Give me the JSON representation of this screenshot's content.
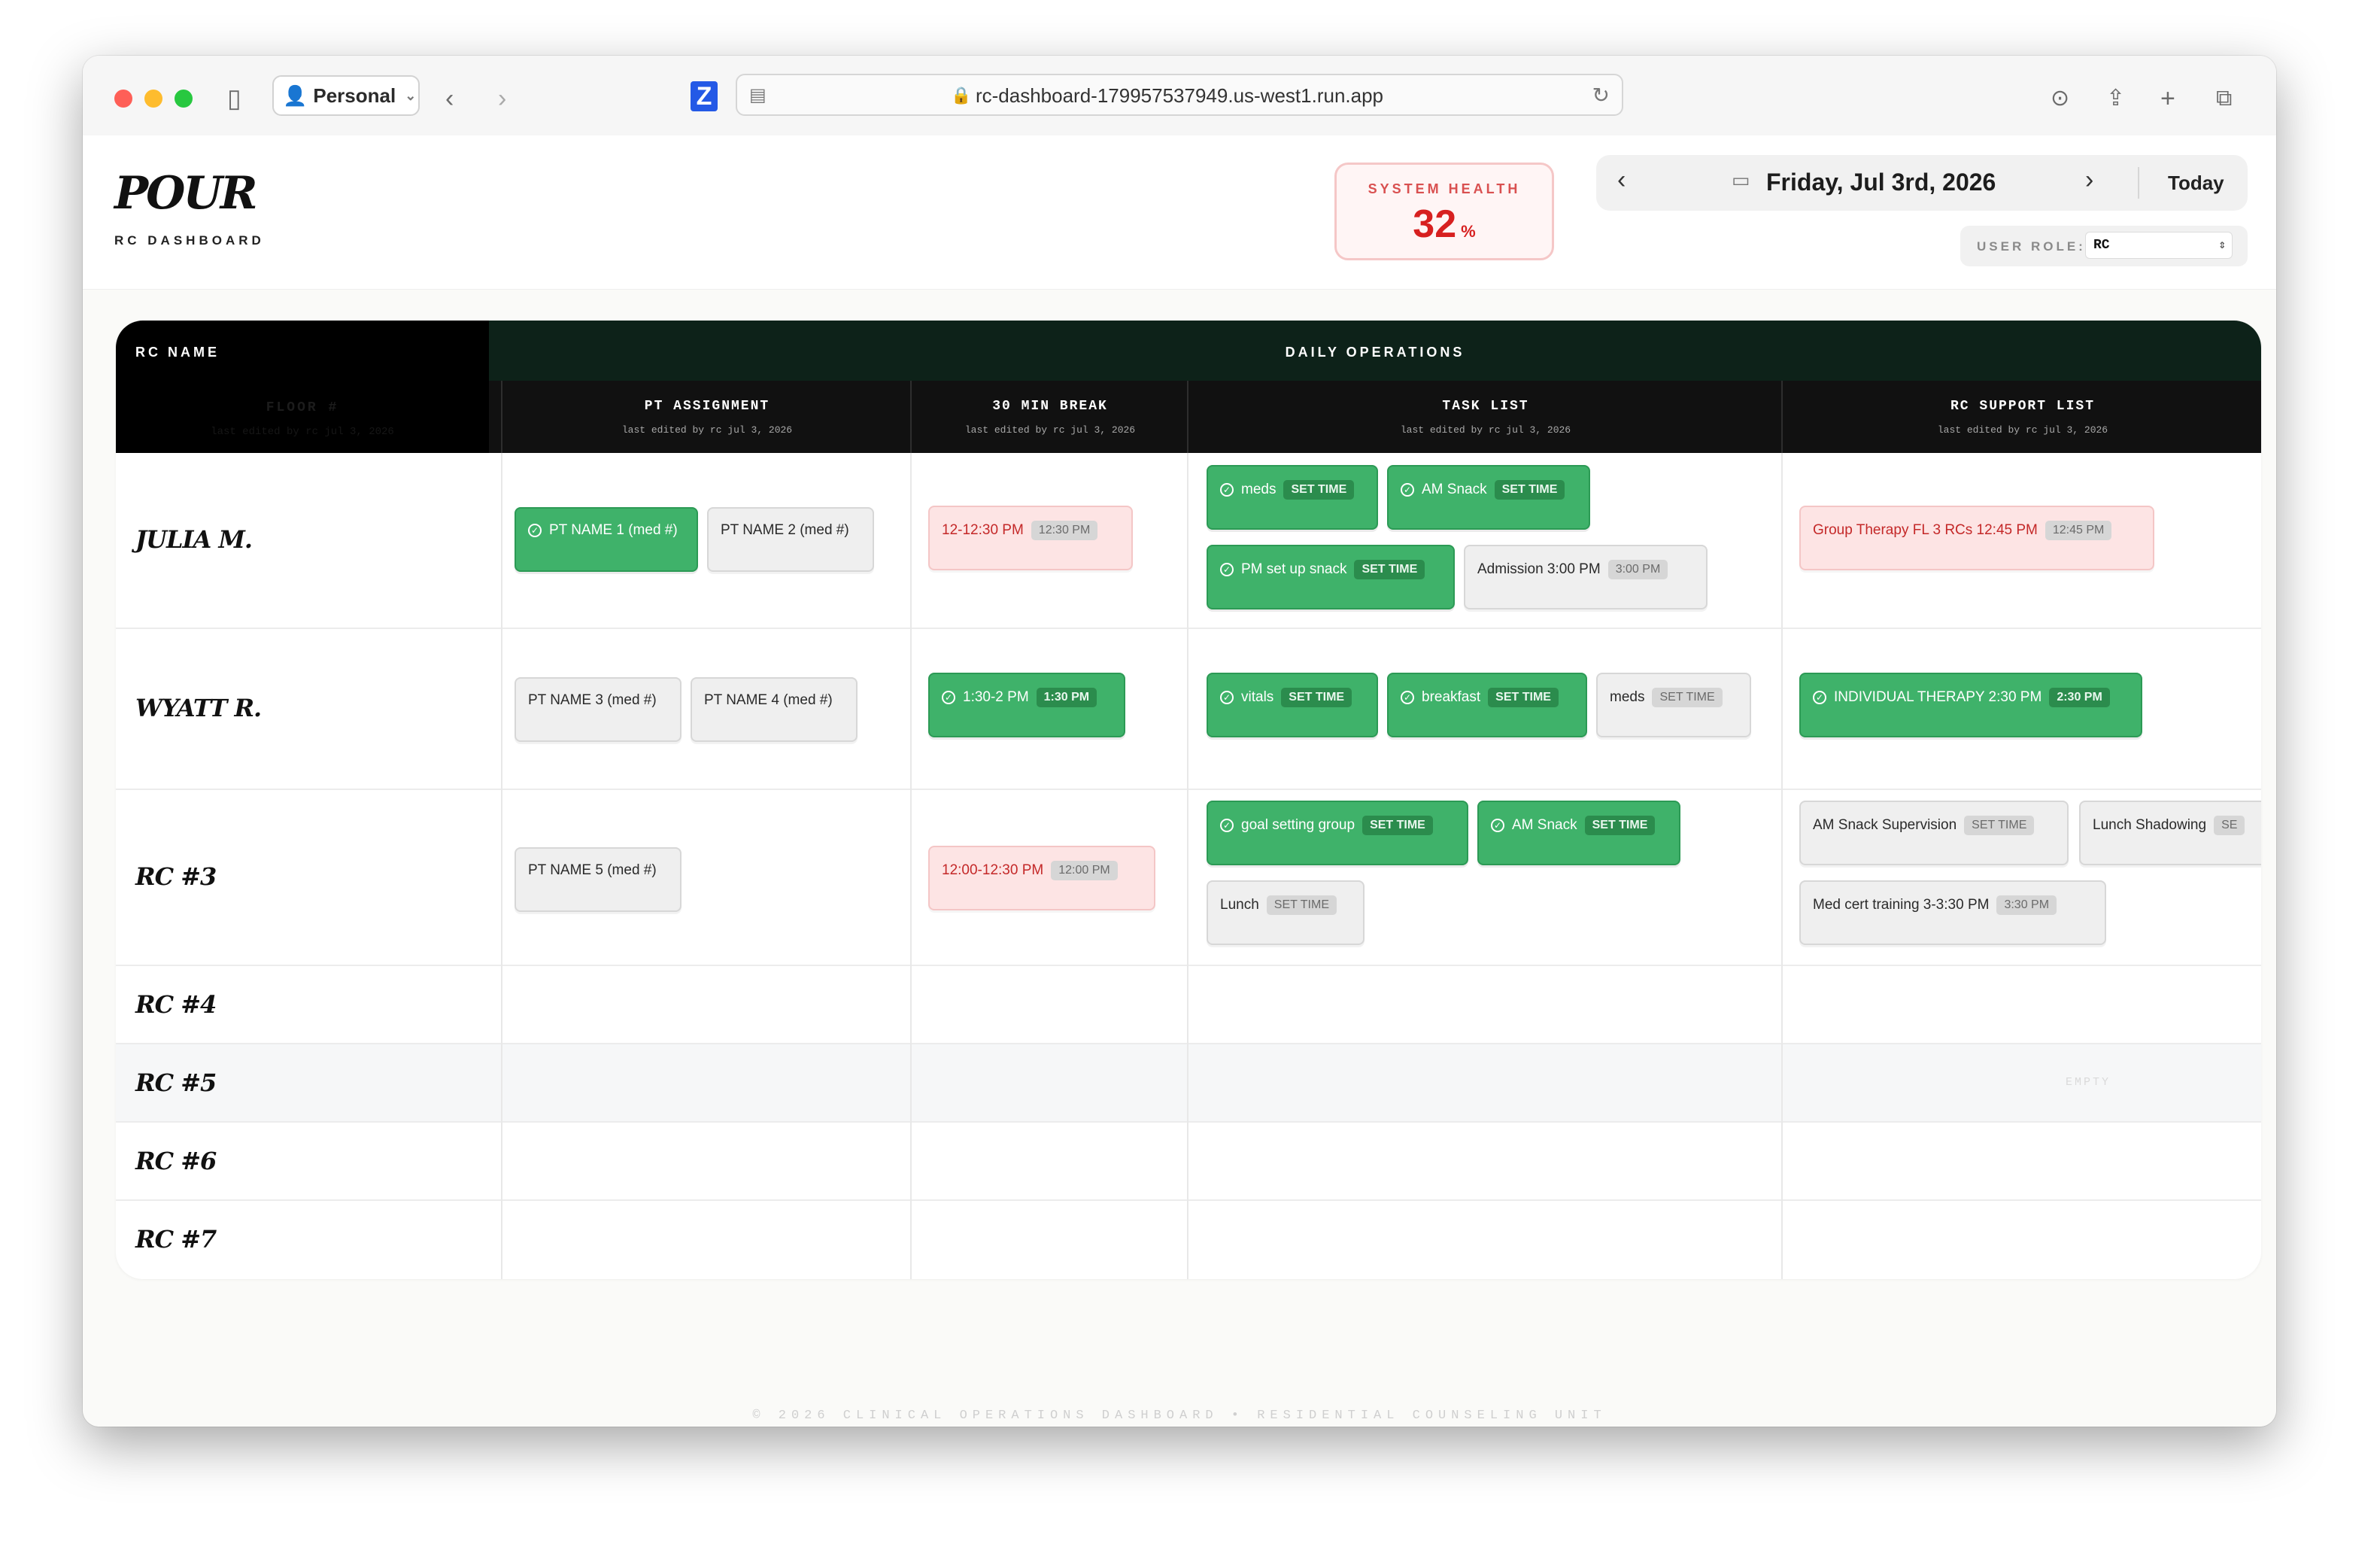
{
  "browser": {
    "profile": "Personal",
    "url": "rc-dashboard-179957537949.us-west1.run.app"
  },
  "header": {
    "logo": "POUR",
    "subtitle": "RC DASHBOARD",
    "health_label": "SYSTEM HEALTH",
    "health_value": "32",
    "health_unit": "%",
    "date": "Friday, Jul 3rd, 2026",
    "today_label": "Today",
    "role_label": "USER ROLE:",
    "role_value": "RC"
  },
  "grid": {
    "rc_header": "RC NAME",
    "floor_label": "FLOOR #",
    "floor_edited": "last edited by rc jul 3, 2026",
    "daily_header": "DAILY OPERATIONS",
    "columns": [
      {
        "title": "PT ASSIGNMENT",
        "edited": "last edited by rc jul 3, 2026"
      },
      {
        "title": "30 MIN BREAK",
        "edited": "last edited by rc jul 3, 2026"
      },
      {
        "title": "TASK LIST",
        "edited": "last edited by rc jul 3, 2026"
      },
      {
        "title": "RC SUPPORT LIST",
        "edited": "last edited by rc jul 3, 2026"
      }
    ],
    "rows": [
      {
        "name": "JULIA M."
      },
      {
        "name": "WYATT R."
      },
      {
        "name": "RC #3"
      },
      {
        "name": "RC #4"
      },
      {
        "name": "RC #5"
      },
      {
        "name": "RC #6"
      },
      {
        "name": "RC #7"
      }
    ],
    "empty_label": "EMPTY"
  },
  "cards": {
    "julia": {
      "pt1": "PT NAME 1 (med #)",
      "pt2": "PT NAME 2 (med #)",
      "break_label": "12-12:30 PM",
      "break_time": "12:30 PM",
      "task_meds": "meds",
      "task_amsnack": "AM Snack",
      "task_pm": "PM set up snack",
      "task_admission": "Admission 3:00 PM",
      "task_admission_time": "3:00 PM",
      "support_group": "Group Therapy FL 3 RCs 12:45 PM",
      "support_group_time": "12:45 PM"
    },
    "wyatt": {
      "pt3": "PT NAME 3 (med #)",
      "pt4": "PT NAME 4 (med #)",
      "break_label": "1:30-2 PM",
      "break_time": "1:30 PM",
      "task_vitals": "vitals",
      "task_breakfast": "breakfast",
      "task_meds": "meds",
      "support_individual": "INDIVIDUAL THERAPY 2:30 PM",
      "support_individual_time": "2:30 PM"
    },
    "rc3": {
      "pt5": "PT NAME 5 (med #)",
      "break_label": "12:00-12:30 PM",
      "break_time": "12:00 PM",
      "task_goal": "goal setting group",
      "task_amsnack": "AM Snack",
      "task_lunch": "Lunch",
      "support_amsnack": "AM Snack Supervision",
      "support_lunch": "Lunch Shadowing",
      "support_lunch_pill": "SE",
      "support_medcert": "Med cert training 3-3:30 PM",
      "support_medcert_time": "3:30 PM"
    },
    "set_time": "SET TIME"
  },
  "footer": "© 2026 CLINICAL OPERATIONS DASHBOARD • RESIDENTIAL COUNSELING UNIT"
}
